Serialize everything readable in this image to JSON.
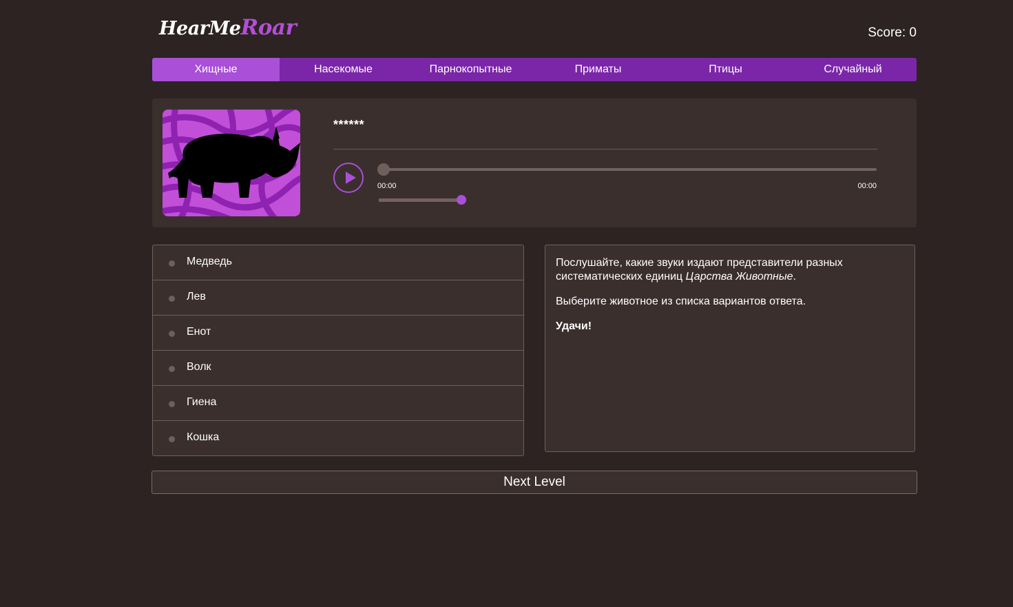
{
  "header": {
    "logo_part1": "HearMe",
    "logo_part2": "Roar",
    "score_label": "Score: 0"
  },
  "nav": {
    "items": [
      {
        "label": "Хищные",
        "active": true
      },
      {
        "label": "Насекомые",
        "active": false
      },
      {
        "label": "Парнокопытные",
        "active": false
      },
      {
        "label": "Приматы",
        "active": false
      },
      {
        "label": "Птицы",
        "active": false
      },
      {
        "label": "Случайный",
        "active": false
      }
    ]
  },
  "player": {
    "hidden_name": "******",
    "image_icon": "rhino-silhouette-icon",
    "current_time": "00:00",
    "duration": "00:00",
    "progress": 0,
    "volume": 0.95
  },
  "answers": [
    {
      "label": "Медведь"
    },
    {
      "label": "Лев"
    },
    {
      "label": "Енот"
    },
    {
      "label": "Волк"
    },
    {
      "label": "Гиена"
    },
    {
      "label": "Кошка"
    }
  ],
  "info": {
    "line1_a": "Послушайте, какие звуки издают представители разных систематических единиц ",
    "line1_em": "Царства Животные",
    "line1_b": ".",
    "line2": "Выберите животное из списка вариантов ответа.",
    "line3": "Удачи!"
  },
  "next_button": "Next Level",
  "colors": {
    "background": "#2c2322",
    "panel": "#3a2f2d",
    "accent": "#a94fd8",
    "nav": "#7b26a8"
  }
}
